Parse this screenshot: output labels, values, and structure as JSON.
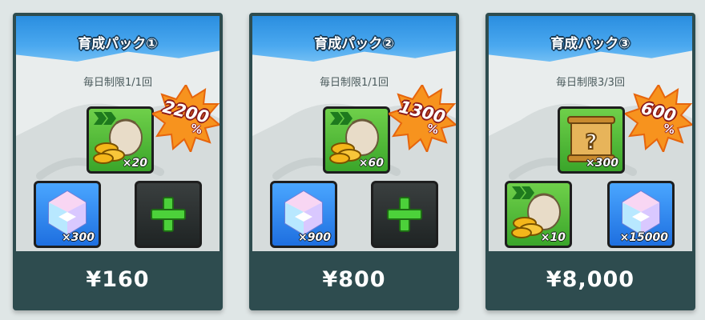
{
  "packs": [
    {
      "title": "育成パック①",
      "limit": "毎日制限1/1回",
      "bonus": "2200",
      "bonus_suffix": "%",
      "price": "¥160",
      "items": [
        {
          "icon": "coin-sack-icon",
          "qty": "×20"
        },
        {
          "icon": "gem-icon",
          "qty": "×300"
        },
        {
          "icon": "plus-icon",
          "qty": ""
        }
      ]
    },
    {
      "title": "育成パック②",
      "limit": "毎日制限1/1回",
      "bonus": "1300",
      "bonus_suffix": "%",
      "price": "¥800",
      "items": [
        {
          "icon": "coin-sack-icon",
          "qty": "×60"
        },
        {
          "icon": "gem-icon",
          "qty": "×900"
        },
        {
          "icon": "plus-icon",
          "qty": ""
        }
      ]
    },
    {
      "title": "育成パック③",
      "limit": "毎日制限3/3回",
      "bonus": "600",
      "bonus_suffix": "%",
      "price": "¥8,000",
      "items": [
        {
          "icon": "mystery-scroll-icon",
          "qty": "×300"
        },
        {
          "icon": "coin-sack-icon",
          "qty": "×10"
        },
        {
          "icon": "gem-icon",
          "qty": "×15000"
        }
      ]
    }
  ],
  "colors": {
    "header_blue": "#2a8ee0",
    "frame": "#2e4c4f",
    "badge_orange": "#f7931e",
    "badge_red": "#b52020",
    "item_green": "#3aa52a",
    "item_blue": "#1e6fe0"
  }
}
